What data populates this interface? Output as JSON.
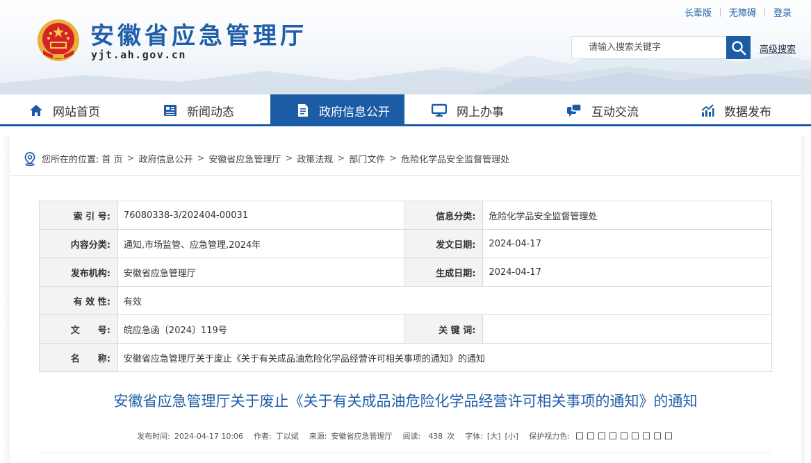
{
  "header": {
    "site_title": "安徽省应急管理厅",
    "site_domain": "yjt.ah.gov.cn",
    "top_links": [
      "长辈版",
      "无障碍",
      "登录"
    ],
    "search_placeholder": "请输入搜索关键字",
    "advanced_search": "高级搜索"
  },
  "nav": {
    "items": [
      {
        "label": "网站首页",
        "icon": "home-icon"
      },
      {
        "label": "新闻动态",
        "icon": "news-icon"
      },
      {
        "label": "政府信息公开",
        "icon": "document-icon",
        "active": true
      },
      {
        "label": "网上办事",
        "icon": "monitor-icon"
      },
      {
        "label": "互动交流",
        "icon": "chat-icon"
      },
      {
        "label": "数据发布",
        "icon": "chart-icon"
      }
    ],
    "accent_color": "#1c5ba6"
  },
  "breadcrumb": {
    "label": "您所在的位置:",
    "items": [
      "首 页",
      "政府信息公开",
      "安徽省应急管理厅",
      "政策法规",
      "部门文件",
      "危险化学品安全监督管理处"
    ]
  },
  "meta": {
    "index_no": {
      "label": "索 引 号:",
      "value": "76080338-3/202404-00031"
    },
    "info_category": {
      "label": "信息分类:",
      "value": "危险化学品安全监督管理处"
    },
    "content_category": {
      "label": "内容分类:",
      "value": "通知,市场监管、应急管理,2024年"
    },
    "issue_date": {
      "label": "发文日期:",
      "value": "2024-04-17"
    },
    "publisher": {
      "label": "发布机构:",
      "value": "安徽省应急管理厅"
    },
    "created_date": {
      "label": "生成日期:",
      "value": "2024-04-17"
    },
    "validity": {
      "label": "有 效 性:",
      "value": "有效"
    },
    "doc_no": {
      "label": "文　　号:",
      "value": "皖应急函〔2024〕119号"
    },
    "keywords": {
      "label": "关 键 词:",
      "value": ""
    },
    "name": {
      "label": "名　　称:",
      "value": "安徽省应急管理厅关于废止《关于有关成品油危险化学品经营许可相关事项的通知》的通知"
    }
  },
  "article": {
    "title": "安徽省应急管理厅关于废止《关于有关成品油危险化学品经营许可相关事项的通知》的通知",
    "publish_time_label": "发布时间:",
    "publish_time": "2024-04-17 10:06",
    "author_label": "作者:",
    "author": "丁以斌",
    "source_label": "来源:",
    "source": "安徽省应急管理厅",
    "views_label": "阅读:",
    "views": "438",
    "views_unit": "次",
    "font_label": "字体:",
    "font_large": "[大]",
    "font_small": "[小]",
    "eye_label": "保护视力色:"
  }
}
